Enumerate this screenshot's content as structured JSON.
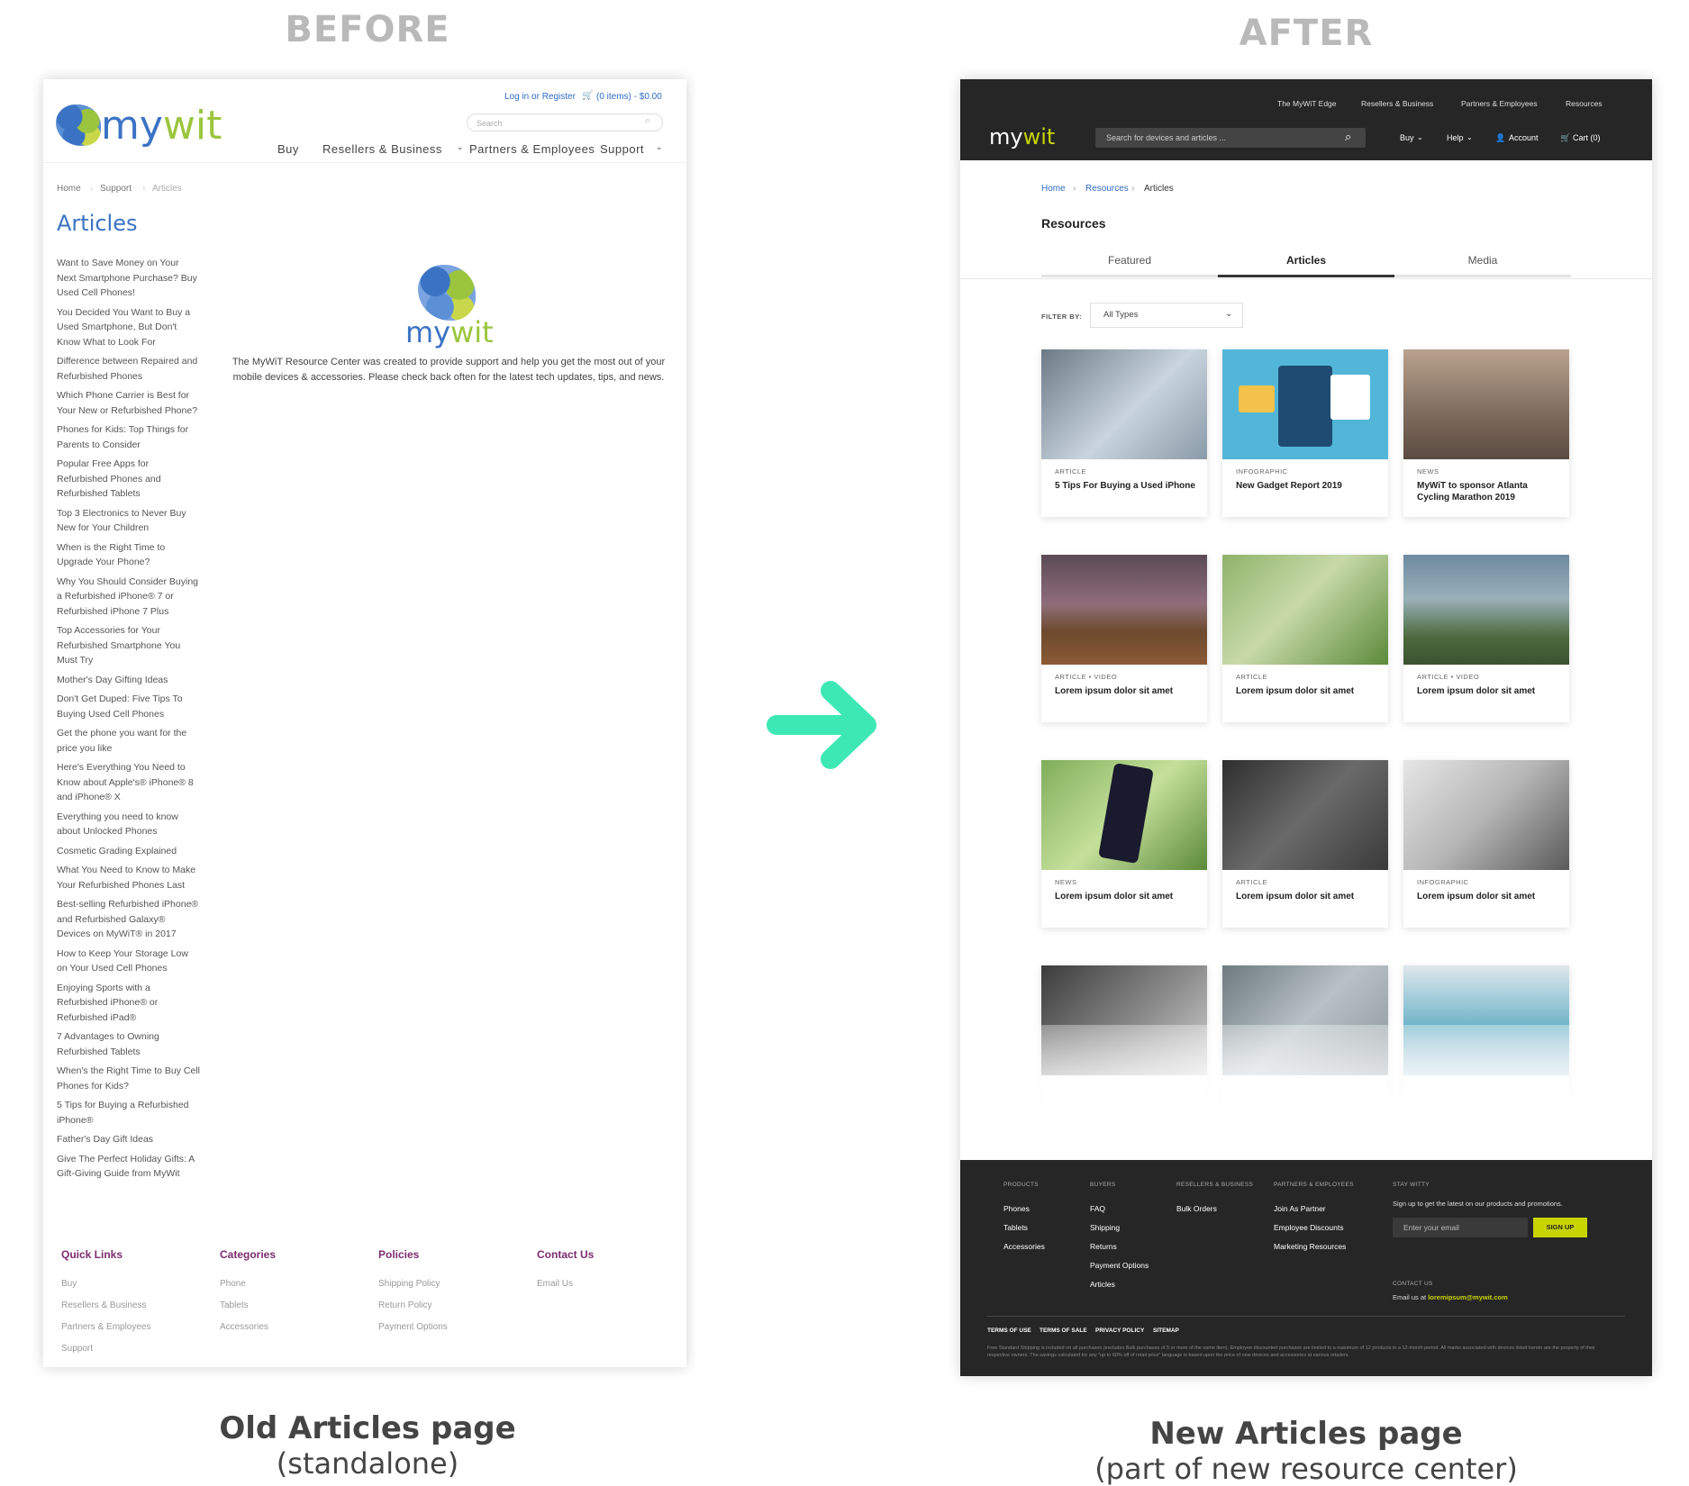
{
  "labels": {
    "before": "BEFORE",
    "after": "AFTER",
    "old_caption_title": "Old Articles page",
    "old_caption_sub": "(standalone)",
    "new_caption_title": "New Articles page",
    "new_caption_sub": "(part of new resource center)"
  },
  "colors": {
    "arrow": "#3ee8b5",
    "old_accent": "#3b73c4",
    "new_accent": "#c8d400"
  },
  "old_page": {
    "logo_my": "my",
    "logo_wit": "wit",
    "login": "Log in or Register",
    "cart": "(0 items) - $0.00",
    "search_placeholder": "Search",
    "nav": [
      "Buy",
      "Resellers & Business",
      "Partners & Employees",
      "Support"
    ],
    "breadcrumb": [
      "Home",
      "Support",
      "Articles"
    ],
    "title": "Articles",
    "articles": [
      "Want to Save Money on Your Next Smartphone Purchase? Buy Used Cell Phones!",
      "You Decided You Want to Buy a Used Smartphone, But Don't Know What to Look For",
      "Difference between Repaired and Refurbished Phones",
      "Which Phone Carrier is Best for Your New or Refurbished Phone?",
      "Phones for Kids: Top Things for Parents to Consider",
      "Popular Free Apps for Refurbished Phones and Refurbished Tablets",
      "Top 3 Electronics to Never Buy New for Your Children",
      "When is the Right Time to Upgrade Your Phone?",
      "Why You Should Consider Buying a Refurbished iPhone® 7 or Refurbished iPhone 7 Plus",
      "Top Accessories for Your Refurbished Smartphone You Must Try",
      "Mother's Day Gifting Ideas",
      "Don't Get Duped: Five Tips To Buying Used Cell Phones",
      "Get the phone you want for the price you like",
      "Here's Everything You Need to Know about Apple's® iPhone® 8 and iPhone® X",
      "Everything you need to know about Unlocked Phones",
      "Cosmetic Grading Explained",
      "What You Need to Know to Make Your Refurbished Phones Last",
      "Best-selling Refurbished iPhone® and Refurbished Galaxy® Devices on MyWiT® in 2017",
      "How to Keep Your Storage Low on Your Used Cell Phones",
      "Enjoying Sports with a Refurbished iPhone® or Refurbished iPad®",
      "7 Advantages to Owning Refurbished Tablets",
      "When's the Right Time to Buy Cell Phones for Kids?",
      "5 Tips for Buying a Refurbished iPhone®",
      "Father's Day Gift Ideas",
      "Give The Perfect Holiday Gifts: A Gift-Giving Guide from MyWit"
    ],
    "intro": "The MyWiT Resource Center was created to provide support and help you get the most out of your mobile devices & accessories.  Please check back often for the latest tech updates, tips, and news.",
    "footer": {
      "quick_links": {
        "title": "Quick Links",
        "items": [
          "Buy",
          "Resellers & Business",
          "Partners & Employees",
          "Support"
        ]
      },
      "categories": {
        "title": "Categories",
        "items": [
          "Phone",
          "Tablets",
          "Accessories"
        ]
      },
      "policies": {
        "title": "Policies",
        "items": [
          "Shipping Policy",
          "Return Policy",
          "Payment Options"
        ]
      },
      "contact": {
        "title": "Contact Us",
        "items": [
          "Email Us"
        ]
      }
    }
  },
  "new_page": {
    "utility_nav": [
      "The MyWiT Edge",
      "Resellers & Business",
      "Partners & Employees",
      "Resources"
    ],
    "logo_my": "my",
    "logo_wit": "wit",
    "search_placeholder": "Search for devices and articles ...",
    "nav": {
      "buy": "Buy",
      "help": "Help",
      "account": "Account",
      "cart": "Cart (0)"
    },
    "breadcrumb": [
      "Home",
      "Resources",
      "Articles"
    ],
    "section_title": "Resources",
    "tabs": [
      "Featured",
      "Articles",
      "Media"
    ],
    "filter_label": "FILTER BY:",
    "filter_value": "All Types",
    "cards": [
      {
        "category": "ARTICLE",
        "title": "5 Tips For Buying a Used iPhone"
      },
      {
        "category": "INFOGRAPHIC",
        "title": "New Gadget Report 2019"
      },
      {
        "category": "NEWS",
        "title": "MyWiT to sponsor Atlanta Cycling Marathon 2019"
      },
      {
        "category": "ARTICLE • VIDEO",
        "title": "Lorem ipsum dolor sit amet"
      },
      {
        "category": "ARTICLE",
        "title": "Lorem ipsum dolor sit amet"
      },
      {
        "category": "ARTICLE • VIDEO",
        "title": "Lorem ipsum dolor sit amet"
      },
      {
        "category": "NEWS",
        "title": "Lorem ipsum dolor sit amet"
      },
      {
        "category": "ARTICLE",
        "title": "Lorem ipsum dolor sit amet"
      },
      {
        "category": "INFOGRAPHIC",
        "title": "Lorem ipsum dolor sit amet"
      },
      {
        "category": "",
        "title": ""
      },
      {
        "category": "",
        "title": ""
      },
      {
        "category": "",
        "title": ""
      }
    ],
    "footer": {
      "products": {
        "title": "PRODUCTS",
        "items": [
          "Phones",
          "Tablets",
          "Accessories"
        ]
      },
      "buyers": {
        "title": "BUYERS",
        "items": [
          "FAQ",
          "Shipping",
          "Returns",
          "Payment Options",
          "Articles"
        ]
      },
      "resellers": {
        "title": "RESELLERS & BUSINESS",
        "items": [
          "Bulk Orders"
        ]
      },
      "partners": {
        "title": "PARTNERS & EMPLOYEES",
        "items": [
          "Join As Partner",
          "Employee Discounts",
          "Marketing Resources"
        ]
      },
      "stay": {
        "title": "STAY WITTY",
        "text": "Sign up to get the latest on our products and promotions.",
        "email_placeholder": "Enter your email",
        "button": "SIGN UP"
      },
      "contact": {
        "title": "CONTACT US",
        "text": "Email us at",
        "email": "loremipsum@mywit.com"
      },
      "legal": [
        "TERMS OF USE",
        "TERMS OF SALE",
        "PRIVACY POLICY",
        "SITEMAP"
      ],
      "fine_print": "Free Standard Shipping is included on all purchases (excludes Bulk purchases of 5 or more of the same item). Employee discounted purchases are limited to a maximum of 12 products in a 12-month period. All marks associated with devices listed herein are the property of their respective owners. The savings calculated for any \"up to 60% off of retail price\" language is based upon the price of new devices and accessories at various retailers."
    }
  }
}
